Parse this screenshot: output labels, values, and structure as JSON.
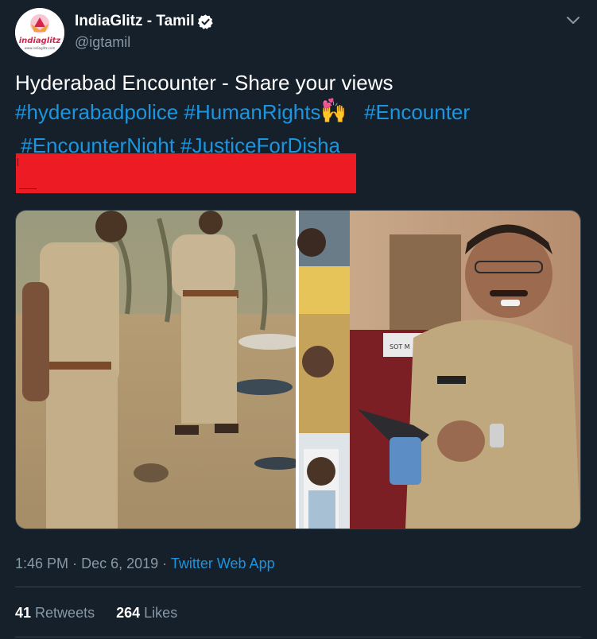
{
  "author": {
    "display_name": "IndiaGlitz - Tamil",
    "handle": "@igtamil",
    "avatar_text": "indiaglitz",
    "avatar_url_text": "www.indiaglitz.com",
    "verified": true
  },
  "tweet": {
    "line1": "Hyderabad Encounter - Share your views",
    "hashtags": [
      "#hyderabadpolice",
      "#HumanRights",
      "#Encounter",
      "#EncounterNight",
      "#JusticeForDisha"
    ],
    "emoji": "🙌",
    "heart_emoji": "💕"
  },
  "media": {
    "poster_text": "SOT M"
  },
  "meta": {
    "time": "1:46 PM",
    "date": "Dec 6, 2019",
    "separator": "·",
    "source": "Twitter Web App"
  },
  "stats": {
    "retweets_count": "41",
    "retweets_label": "Retweets",
    "likes_count": "264",
    "likes_label": "Likes"
  },
  "colors": {
    "background": "#15202b",
    "link": "#1b95e0",
    "secondary_text": "#8899a6",
    "divider": "#38444d",
    "redaction": "#ed1c24",
    "verified_badge": "#ffffff"
  },
  "icons": {
    "verified": "verified-badge-icon",
    "caret": "chevron-down-icon"
  }
}
